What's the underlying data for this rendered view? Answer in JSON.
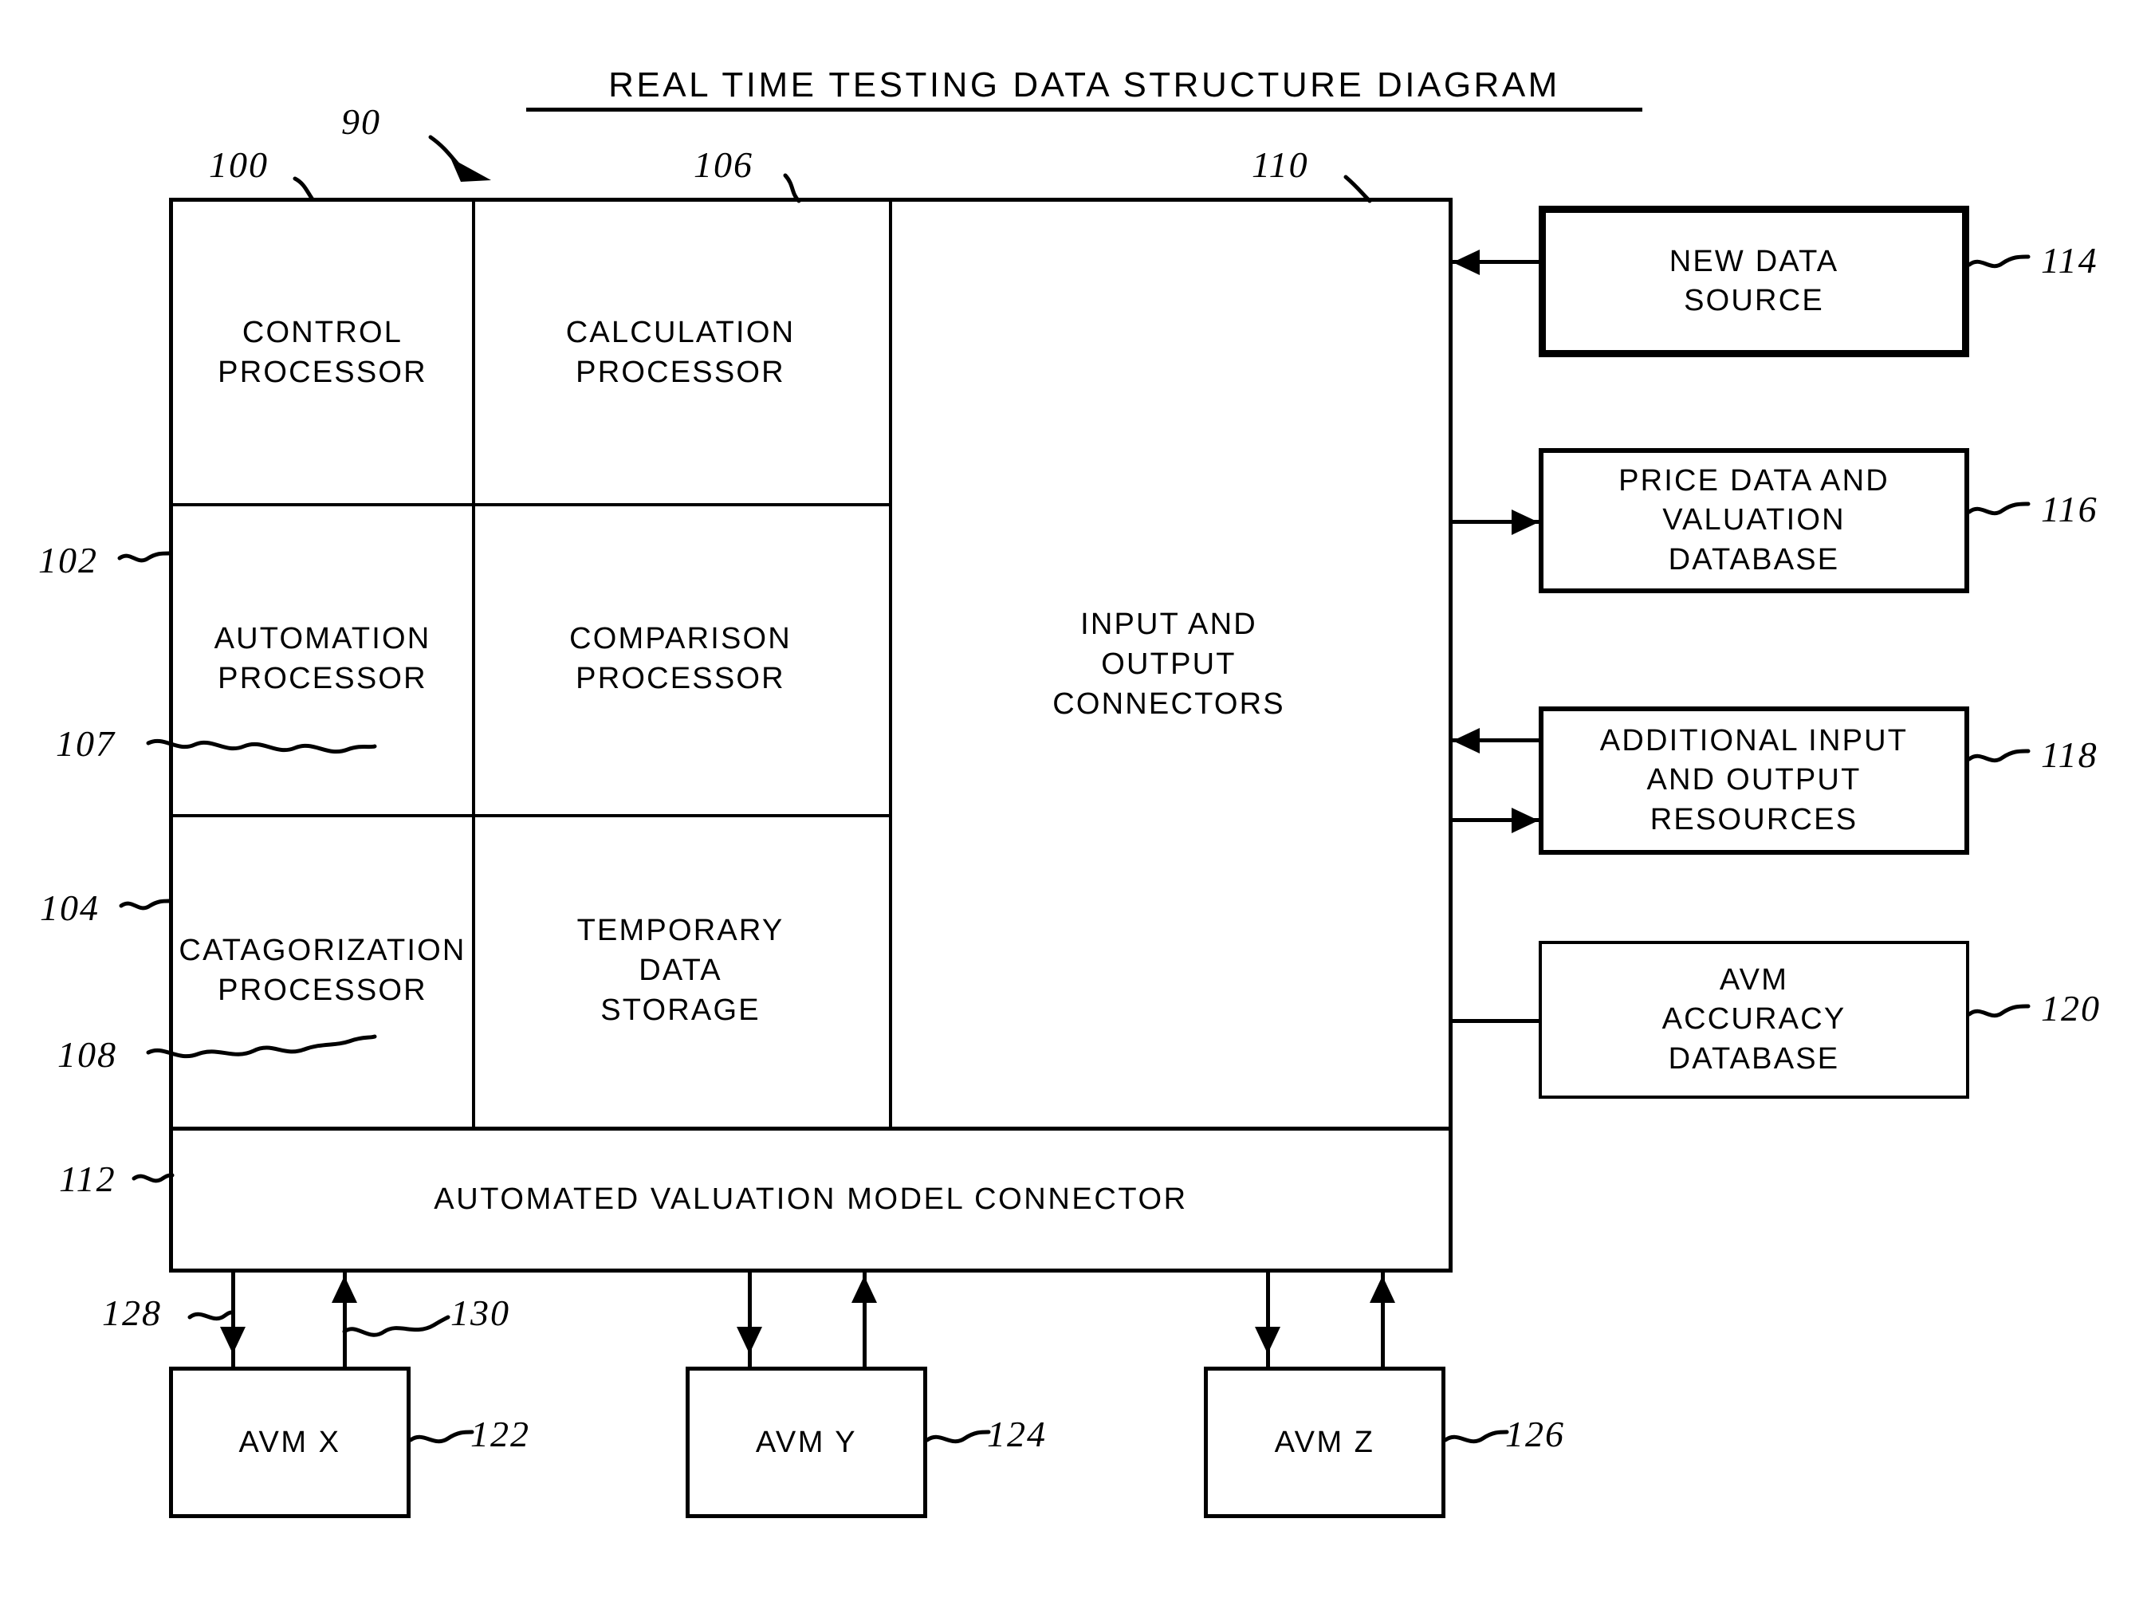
{
  "title": "REAL TIME TESTING DATA STRUCTURE DIAGRAM",
  "figure_ref": "90",
  "main_box": {
    "ref_top_left": "100",
    "ref_top_mid": "106",
    "ref_top_right": "110",
    "cells": [
      {
        "ref": "100",
        "label": "CONTROL\nPROCESSOR"
      },
      {
        "ref": "106",
        "label": "CALCULATION\nPROCESSOR"
      },
      {
        "ref": "110",
        "label": "INPUT AND\nOUTPUT\nCONNECTORS"
      },
      {
        "ref": "102",
        "label": "AUTOMATION\nPROCESSOR"
      },
      {
        "ref": "",
        "label": "COMPARISON\nPROCESSOR"
      },
      {
        "ref": "104",
        "label": "CATAGORIZATION\nPROCESSOR"
      },
      {
        "ref": "",
        "label": "TEMPORARY\nDATA\nSTORAGE"
      }
    ],
    "cell_labels": {
      "control_processor": "CONTROL PROCESSOR",
      "calculation_processor": "CALCULATION PROCESSOR",
      "input_output_connectors": "INPUT AND OUTPUT CONNECTORS",
      "automation_processor": "AUTOMATION PROCESSOR",
      "comparison_processor": "COMPARISON PROCESSOR",
      "catagorization_processor": "CATAGORIZATION PROCESSOR",
      "temporary_data_storage": "TEMPORARY DATA STORAGE"
    },
    "cell_lines": {
      "control_1": "CONTROL",
      "control_2": "PROCESSOR",
      "calculation_1": "CALCULATION",
      "calculation_2": "PROCESSOR",
      "io_1": "INPUT AND",
      "io_2": "OUTPUT",
      "io_3": "CONNECTORS",
      "automation_1": "AUTOMATION",
      "automation_2": "PROCESSOR",
      "comparison_1": "COMPARISON",
      "comparison_2": "PROCESSOR",
      "catagorization_1": "CATAGORIZATION",
      "catagorization_2": "PROCESSOR",
      "temporary_1": "TEMPORARY",
      "temporary_2": "DATA",
      "temporary_3": "STORAGE"
    },
    "connector_bar": {
      "ref": "112",
      "label": "AUTOMATED VALUATION MODEL CONNECTOR"
    }
  },
  "refs": {
    "r90": "90",
    "r100": "100",
    "r102": "102",
    "r104": "104",
    "r106": "106",
    "r107": "107",
    "r108": "108",
    "r110": "110",
    "r112": "112",
    "r114": "114",
    "r116": "116",
    "r118": "118",
    "r120": "120",
    "r122": "122",
    "r124": "124",
    "r126": "126",
    "r128": "128",
    "r130": "130"
  },
  "side_boxes": [
    {
      "ref": "114",
      "lines": [
        "NEW DATA",
        "SOURCE"
      ],
      "label": "NEW DATA SOURCE",
      "border": "heavy",
      "flow": "in"
    },
    {
      "ref": "116",
      "lines": [
        "PRICE DATA AND",
        "VALUATION",
        "DATABASE"
      ],
      "label": "PRICE DATA AND VALUATION DATABASE",
      "border": "semi",
      "flow": "out"
    },
    {
      "ref": "118",
      "lines": [
        "ADDITIONAL INPUT",
        "AND OUTPUT",
        "RESOURCES"
      ],
      "label": "ADDITIONAL INPUT AND OUTPUT RESOURCES",
      "border": "semi",
      "flow": "both"
    },
    {
      "ref": "120",
      "lines": [
        "AVM",
        "ACCURACY",
        "DATABASE"
      ],
      "label": "AVM ACCURACY DATABASE",
      "border": "normal",
      "flow": "plain"
    }
  ],
  "avm_boxes": [
    {
      "ref": "122",
      "label": "AVM X",
      "in_ref": "128",
      "out_ref": "130"
    },
    {
      "ref": "124",
      "label": "AVM Y"
    },
    {
      "ref": "126",
      "label": "AVM Z"
    }
  ],
  "colors": {
    "ink": "#000000",
    "paper": "#ffffff"
  }
}
